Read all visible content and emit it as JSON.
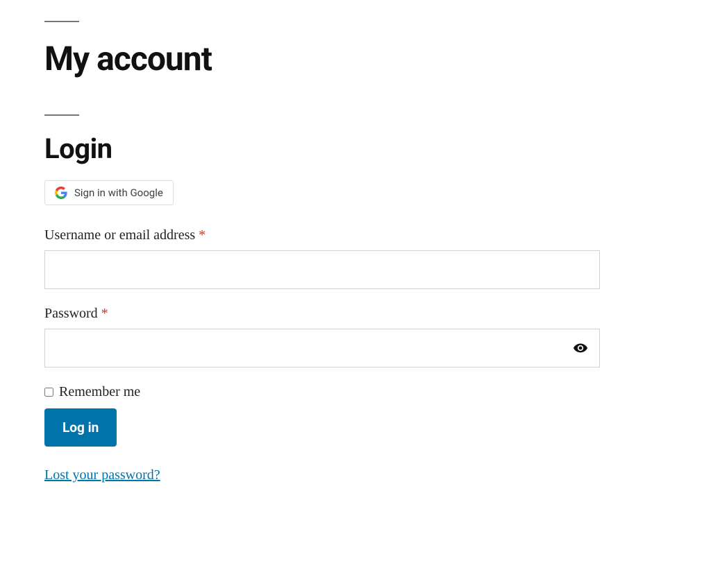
{
  "page": {
    "title": "My account"
  },
  "login": {
    "heading": "Login",
    "google_button": "Sign in with Google",
    "username_label": "Username or email address",
    "password_label": "Password",
    "required_mark": "*",
    "remember_label": "Remember me",
    "submit_label": "Log in",
    "lost_password": "Lost your password?"
  }
}
